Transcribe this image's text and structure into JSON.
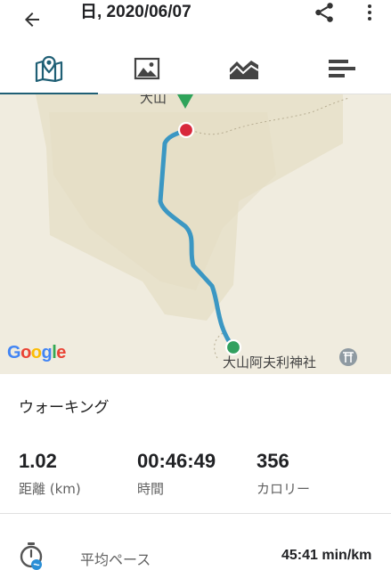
{
  "header": {
    "title": "日, 2020/06/07",
    "back_icon": "arrow-left-icon",
    "share_icon": "share-icon",
    "more_icon": "more-vert-icon"
  },
  "tabs": [
    {
      "icon": "map-pin-icon",
      "active": true
    },
    {
      "icon": "photo-icon",
      "active": false
    },
    {
      "icon": "chart-area-icon",
      "active": false
    },
    {
      "icon": "bar-list-icon",
      "active": false
    }
  ],
  "map": {
    "summit_label": "大山",
    "shrine_label": "大山阿夫利神社",
    "logo_text": "Google",
    "route_color": "#3b97c3",
    "start_color": "#31a05f",
    "end_color": "#d8283c"
  },
  "activity": {
    "name": "ウォーキング"
  },
  "stats": [
    {
      "value": "1.02",
      "label": "距離 (km)"
    },
    {
      "value": "00:46:49",
      "label": "時間"
    },
    {
      "value": "356",
      "label": "カロリー"
    }
  ],
  "pace": {
    "label": "平均ペース",
    "value": "45:41 min/km"
  },
  "colors": {
    "accent": "#1f5f75",
    "map_background": "#f0ecdf"
  }
}
